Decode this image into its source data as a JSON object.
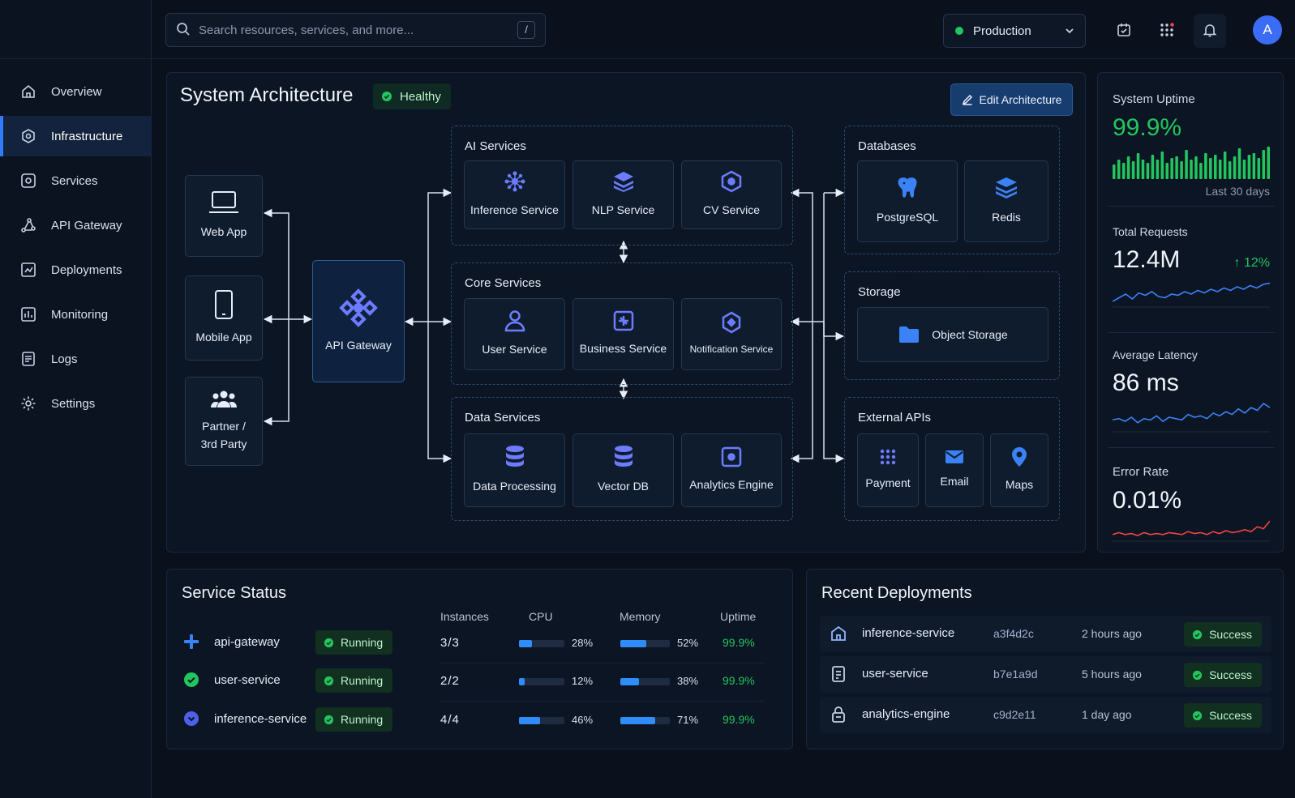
{
  "search": {
    "placeholder": "Search resources, services, and more...",
    "shortcut": "/"
  },
  "environment": {
    "selected": "Production",
    "status_color": "#22c55e"
  },
  "user": {
    "initial": "A"
  },
  "sidebar": {
    "items": [
      {
        "label": "Overview",
        "icon": "home-icon"
      },
      {
        "label": "Infrastructure",
        "icon": "infrastructure-icon",
        "active": true
      },
      {
        "label": "Services",
        "icon": "services-gear-icon"
      },
      {
        "label": "API Gateway",
        "icon": "api-gateway-icon"
      },
      {
        "label": "Deployments",
        "icon": "deployments-icon"
      },
      {
        "label": "Monitoring",
        "icon": "monitoring-icon"
      },
      {
        "label": "Logs",
        "icon": "logs-icon"
      },
      {
        "label": "Settings",
        "icon": "settings-icon"
      }
    ]
  },
  "architecture": {
    "title": "System Architecture",
    "health": "Healthy",
    "edit_label": "Edit Architecture",
    "clients": {
      "web": "Web App",
      "mobile": "Mobile App",
      "partner_line1": "Partner /",
      "partner_line2": "3rd Party"
    },
    "gateway": "API Gateway",
    "ai": {
      "title": "AI Services",
      "n1": "Inference Service",
      "n2": "NLP Service",
      "n3": "CV Service"
    },
    "core": {
      "title": "Core Services",
      "n1": "User Service",
      "n2": "Business Service",
      "n3": "Notification Service"
    },
    "data": {
      "title": "Data Services",
      "n1": "Data Processing",
      "n2": "Vector DB",
      "n3": "Analytics Engine"
    },
    "databases": {
      "title": "Databases",
      "n1": "PostgreSQL",
      "n2": "Redis"
    },
    "storage": {
      "title": "Storage",
      "n1": "Object Storage"
    },
    "external": {
      "title": "External APIs",
      "n1": "Payment",
      "n2": "Email",
      "n3": "Maps"
    }
  },
  "metrics": {
    "uptime": {
      "label": "System Uptime",
      "value": "99.9%",
      "period": "Last 30 days",
      "color": "#22c55e",
      "bars": [
        0.45,
        0.6,
        0.5,
        0.7,
        0.55,
        0.8,
        0.6,
        0.5,
        0.75,
        0.6,
        0.85,
        0.5,
        0.65,
        0.7,
        0.55,
        0.9,
        0.6,
        0.7,
        0.5,
        0.8,
        0.65,
        0.75,
        0.6,
        0.85,
        0.55,
        0.7,
        0.95,
        0.6,
        0.75,
        0.8,
        0.65,
        0.9,
        1.0
      ]
    },
    "requests": {
      "label": "Total Requests",
      "value": "12.4M",
      "change": "12%",
      "color": "#3b82f6",
      "trend": [
        0.2,
        0.35,
        0.5,
        0.3,
        0.55,
        0.45,
        0.6,
        0.4,
        0.35,
        0.5,
        0.45,
        0.6,
        0.5,
        0.65,
        0.55,
        0.7,
        0.6,
        0.75,
        0.65,
        0.8,
        0.7,
        0.85,
        0.75,
        0.9,
        0.95
      ]
    },
    "latency": {
      "label": "Average Latency",
      "value": "86 ms",
      "color": "#3b82f6",
      "trend": [
        0.4,
        0.45,
        0.35,
        0.5,
        0.3,
        0.45,
        0.4,
        0.55,
        0.35,
        0.5,
        0.45,
        0.4,
        0.6,
        0.5,
        0.55,
        0.45,
        0.65,
        0.55,
        0.7,
        0.6,
        0.8,
        0.65,
        0.85,
        0.75,
        1.0,
        0.85
      ]
    },
    "errors": {
      "label": "Error Rate",
      "value": "0.01%",
      "color": "#ef4444",
      "trend": [
        0.3,
        0.4,
        0.3,
        0.35,
        0.25,
        0.4,
        0.3,
        0.35,
        0.3,
        0.4,
        0.35,
        0.3,
        0.45,
        0.35,
        0.4,
        0.3,
        0.45,
        0.35,
        0.5,
        0.4,
        0.45,
        0.55,
        0.45,
        0.7,
        0.6,
        1.0
      ]
    }
  },
  "service_status": {
    "title": "Service Status",
    "columns": {
      "instances": "Instances",
      "cpu": "CPU",
      "memory": "Memory",
      "uptime": "Uptime"
    },
    "rows": [
      {
        "name": "api-gateway",
        "status": "Running",
        "instances": "3/3",
        "cpu": 28,
        "cpu_label": "28%",
        "mem": 52,
        "mem_label": "52%",
        "uptime": "99.9%",
        "icon": "plus-cross-icon"
      },
      {
        "name": "user-service",
        "status": "Running",
        "instances": "2/2",
        "cpu": 12,
        "cpu_label": "12%",
        "mem": 38,
        "mem_label": "38%",
        "uptime": "99.9%",
        "icon": "check-circle-icon"
      },
      {
        "name": "inference-service",
        "status": "Running",
        "instances": "4/4",
        "cpu": 46,
        "cpu_label": "46%",
        "mem": 71,
        "mem_label": "71%",
        "uptime": "99.9%",
        "icon": "chevron-circle-icon"
      }
    ]
  },
  "deployments": {
    "title": "Recent Deployments",
    "rows": [
      {
        "name": "inference-service",
        "hash": "a3f4d2c",
        "time": "2 hours ago",
        "status": "Success"
      },
      {
        "name": "user-service",
        "hash": "b7e1a9d",
        "time": "5 hours ago",
        "status": "Success"
      },
      {
        "name": "analytics-engine",
        "hash": "c9d2e11",
        "time": "1 day ago",
        "status": "Success"
      }
    ]
  },
  "colors": {
    "accent": "#2f7cf6",
    "success": "#22c55e",
    "danger": "#ef4444",
    "background": "#0a111d"
  }
}
